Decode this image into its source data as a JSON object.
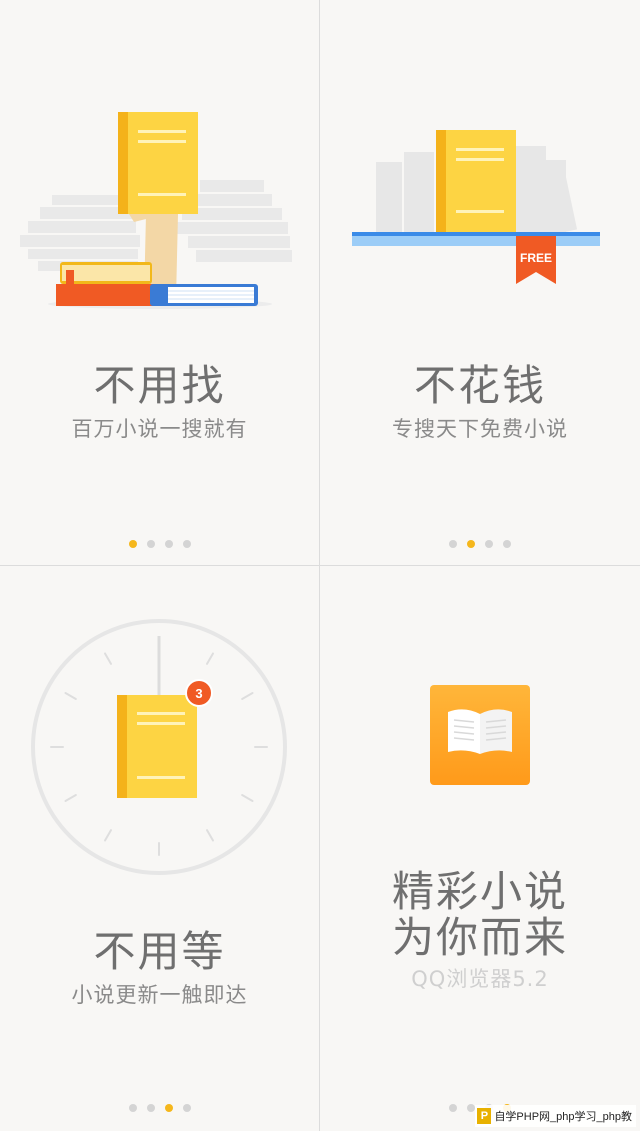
{
  "panels": [
    {
      "title": "不用找",
      "subtitle": "百万小说一搜就有",
      "dots_active_index": 0
    },
    {
      "title": "不花钱",
      "subtitle": "专搜天下免费小说",
      "ribbon": "FREE",
      "dots_active_index": 1
    },
    {
      "title": "不用等",
      "subtitle": "小说更新一触即达",
      "badge": "3",
      "dots_active_index": 2
    },
    {
      "title_line1": "精彩小说",
      "title_line2": "为你而来",
      "subtitle": "QQ浏览器5.2",
      "dots_active_index": 3
    }
  ],
  "watermark": {
    "logo": "P",
    "text": "自学PHP网_php学习_php教"
  },
  "colors": {
    "background": "#f8f7f5",
    "book_yellow": "#fdd443",
    "book_spine": "#f4b21a",
    "ribbon_orange": "#f05a24",
    "shelf_blue": "#9ccdf7",
    "dot_active": "#f5b71c",
    "dot_inactive": "#d4d4d4"
  }
}
